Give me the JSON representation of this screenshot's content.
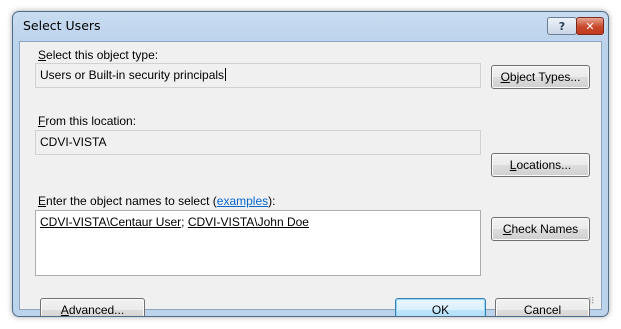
{
  "window": {
    "title": "Select Users",
    "help_glyph": "?",
    "close_glyph": "✕"
  },
  "object_type": {
    "label": "Select this object type:",
    "label_accel": "S",
    "label_rest": "elect this object type:",
    "value": "Users or Built-in security principals",
    "button_label": "Object Types...",
    "button_accel": "O",
    "button_rest": "bject Types..."
  },
  "location": {
    "label": "From this location:",
    "label_accel": "F",
    "label_rest": "rom this location:",
    "value": "CDVI-VISTA",
    "button_label": "Locations...",
    "button_accel": "L",
    "button_rest": "ocations..."
  },
  "names": {
    "label_prefix_accel": "E",
    "label_prefix_rest": "nter the object names to select (",
    "examples_link": "examples",
    "label_suffix": "):",
    "entries": [
      "CDVI-VISTA\\Centaur User",
      "CDVI-VISTA\\John Doe"
    ],
    "separator": "; ",
    "check_button_accel": "C",
    "check_button_rest": "heck Names"
  },
  "footer": {
    "advanced_accel": "A",
    "advanced_rest": "dvanced...",
    "ok_label": "OK",
    "cancel_label": "Cancel"
  },
  "colors": {
    "link": "#0066cc",
    "default_button_border": "#3c7fb1",
    "close_button": "#c8482b"
  },
  "icons": {
    "help": "question-mark",
    "close": "x-mark",
    "resize_grip": "dots-grip"
  }
}
